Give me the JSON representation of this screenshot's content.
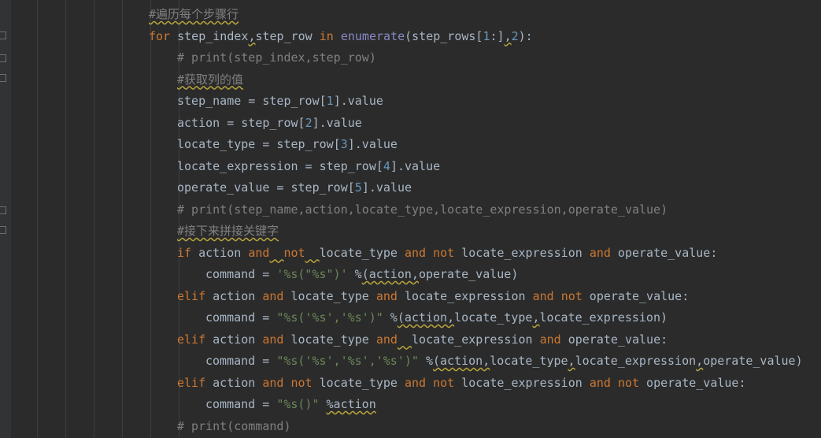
{
  "editor": {
    "colors": {
      "background": "#2b2b2b",
      "keyword": "#cc7832",
      "comment": "#808080",
      "string": "#6a8759",
      "number": "#6897bb",
      "builtin": "#8888c6",
      "identifier": "#a9b7c6"
    },
    "lines": [
      {
        "indent": 189,
        "tokens": [
          {
            "t": "#遍历每个步骤行",
            "c": "cm",
            "sq": true
          }
        ]
      },
      {
        "indent": 189,
        "tokens": [
          {
            "t": "for",
            "c": "kw"
          },
          {
            "t": " step_index",
            "c": "id"
          },
          {
            "t": ",",
            "c": "pu",
            "sq": true
          },
          {
            "t": "step_row ",
            "c": "id"
          },
          {
            "t": "in",
            "c": "kw"
          },
          {
            "t": " ",
            "c": "id"
          },
          {
            "t": "enumerate",
            "c": "fn"
          },
          {
            "t": "(step_rows[",
            "c": "id"
          },
          {
            "t": "1",
            "c": "nm"
          },
          {
            "t": ":]",
            "c": "id"
          },
          {
            "t": ",",
            "c": "pu",
            "sq": true
          },
          {
            "t": "2",
            "c": "nm"
          },
          {
            "t": "):",
            "c": "id"
          }
        ]
      },
      {
        "indent": 225,
        "tokens": [
          {
            "t": "# print(step_index,step_row)",
            "c": "cm"
          }
        ]
      },
      {
        "indent": 225,
        "tokens": [
          {
            "t": "#获取列的值",
            "c": "cm",
            "sq": true
          }
        ]
      },
      {
        "indent": 225,
        "tokens": [
          {
            "t": "step_name = step_row[",
            "c": "id"
          },
          {
            "t": "1",
            "c": "nm"
          },
          {
            "t": "].value",
            "c": "id"
          }
        ]
      },
      {
        "indent": 225,
        "tokens": [
          {
            "t": "action = step_row[",
            "c": "id"
          },
          {
            "t": "2",
            "c": "nm"
          },
          {
            "t": "].value",
            "c": "id"
          }
        ]
      },
      {
        "indent": 225,
        "tokens": [
          {
            "t": "locate_type = step_row[",
            "c": "id"
          },
          {
            "t": "3",
            "c": "nm"
          },
          {
            "t": "].value",
            "c": "id"
          }
        ]
      },
      {
        "indent": 225,
        "tokens": [
          {
            "t": "locate_expression = step_row[",
            "c": "id"
          },
          {
            "t": "4",
            "c": "nm"
          },
          {
            "t": "].value",
            "c": "id"
          }
        ]
      },
      {
        "indent": 225,
        "tokens": [
          {
            "t": "operate_value = step_row[",
            "c": "id"
          },
          {
            "t": "5",
            "c": "nm"
          },
          {
            "t": "].value",
            "c": "id"
          }
        ]
      },
      {
        "indent": 225,
        "tokens": [
          {
            "t": "# print(step_name,action,locate_type,locate_expression,operate_value)",
            "c": "cm"
          }
        ]
      },
      {
        "indent": 225,
        "tokens": [
          {
            "t": "#接下来拼接关键字",
            "c": "cm",
            "sq": true
          }
        ]
      },
      {
        "indent": 225,
        "tokens": [
          {
            "t": "if",
            "c": "kw"
          },
          {
            "t": " action ",
            "c": "id"
          },
          {
            "t": "and",
            "c": "kw"
          },
          {
            "t": "  ",
            "c": "id",
            "sq": true
          },
          {
            "t": "not",
            "c": "kw"
          },
          {
            "t": "  ",
            "c": "id",
            "sq": true
          },
          {
            "t": "locate_type ",
            "c": "id"
          },
          {
            "t": "and",
            "c": "kw"
          },
          {
            "t": " ",
            "c": "id"
          },
          {
            "t": "not",
            "c": "kw"
          },
          {
            "t": " locate_expression ",
            "c": "id"
          },
          {
            "t": "and",
            "c": "kw"
          },
          {
            "t": " operate_value:",
            "c": "id"
          }
        ]
      },
      {
        "indent": 261,
        "tokens": [
          {
            "t": "command = ",
            "c": "id"
          },
          {
            "t": "'%s(\"%s\")'",
            "c": "st"
          },
          {
            "t": " %",
            "c": "id"
          },
          {
            "t": "(action",
            "c": "id",
            "sq": true
          },
          {
            "t": ",",
            "c": "pu",
            "sq": true
          },
          {
            "t": "operate_value)",
            "c": "id"
          }
        ]
      },
      {
        "indent": 225,
        "tokens": [
          {
            "t": "elif",
            "c": "kw"
          },
          {
            "t": " action ",
            "c": "id"
          },
          {
            "t": "and",
            "c": "kw"
          },
          {
            "t": " locate_type ",
            "c": "id"
          },
          {
            "t": "and",
            "c": "kw"
          },
          {
            "t": " locate_expression ",
            "c": "id"
          },
          {
            "t": "and",
            "c": "kw"
          },
          {
            "t": " ",
            "c": "id"
          },
          {
            "t": "not",
            "c": "kw"
          },
          {
            "t": " operate_value:",
            "c": "id"
          }
        ]
      },
      {
        "indent": 261,
        "tokens": [
          {
            "t": "command = ",
            "c": "id"
          },
          {
            "t": "\"%s('%s','%s')\"",
            "c": "st"
          },
          {
            "t": " %",
            "c": "id"
          },
          {
            "t": "(action",
            "c": "id",
            "sq": true
          },
          {
            "t": ",",
            "c": "pu",
            "sq": true
          },
          {
            "t": "locate_type",
            "c": "id"
          },
          {
            "t": ",",
            "c": "pu",
            "sq": true
          },
          {
            "t": "locate_expression)",
            "c": "id"
          }
        ]
      },
      {
        "indent": 225,
        "tokens": [
          {
            "t": "elif",
            "c": "kw"
          },
          {
            "t": " action ",
            "c": "id"
          },
          {
            "t": "and",
            "c": "kw"
          },
          {
            "t": " locate_type ",
            "c": "id"
          },
          {
            "t": "and",
            "c": "kw"
          },
          {
            "t": "  ",
            "c": "id",
            "sq": true
          },
          {
            "t": "locate_expression ",
            "c": "id"
          },
          {
            "t": "and",
            "c": "kw"
          },
          {
            "t": " operate_value:",
            "c": "id"
          }
        ]
      },
      {
        "indent": 261,
        "tokens": [
          {
            "t": "command = ",
            "c": "id"
          },
          {
            "t": "\"%s('%s','%s','%s')\"",
            "c": "st"
          },
          {
            "t": " %",
            "c": "id"
          },
          {
            "t": "(action",
            "c": "id",
            "sq": true
          },
          {
            "t": ",",
            "c": "pu",
            "sq": true
          },
          {
            "t": "locate_type",
            "c": "id"
          },
          {
            "t": ",",
            "c": "pu",
            "sq": true
          },
          {
            "t": "locate_expression",
            "c": "id"
          },
          {
            "t": ",",
            "c": "pu",
            "sq": true
          },
          {
            "t": "operate_value)",
            "c": "id"
          }
        ]
      },
      {
        "indent": 225,
        "tokens": [
          {
            "t": "elif",
            "c": "kw"
          },
          {
            "t": " action ",
            "c": "id"
          },
          {
            "t": "and",
            "c": "kw"
          },
          {
            "t": " ",
            "c": "id"
          },
          {
            "t": "not",
            "c": "kw"
          },
          {
            "t": " locate_type ",
            "c": "id"
          },
          {
            "t": "and",
            "c": "kw"
          },
          {
            "t": " ",
            "c": "id"
          },
          {
            "t": "not",
            "c": "kw"
          },
          {
            "t": " locate_expression ",
            "c": "id"
          },
          {
            "t": "and",
            "c": "kw"
          },
          {
            "t": " ",
            "c": "id"
          },
          {
            "t": "not",
            "c": "kw"
          },
          {
            "t": " operate_value:",
            "c": "id"
          }
        ]
      },
      {
        "indent": 261,
        "tokens": [
          {
            "t": "command = ",
            "c": "id"
          },
          {
            "t": "\"%s()\"",
            "c": "st"
          },
          {
            "t": " ",
            "c": "id"
          },
          {
            "t": "%action",
            "c": "id",
            "sq": true
          }
        ]
      },
      {
        "indent": 225,
        "tokens": [
          {
            "t": "# print(command)",
            "c": "cm"
          }
        ]
      }
    ]
  }
}
